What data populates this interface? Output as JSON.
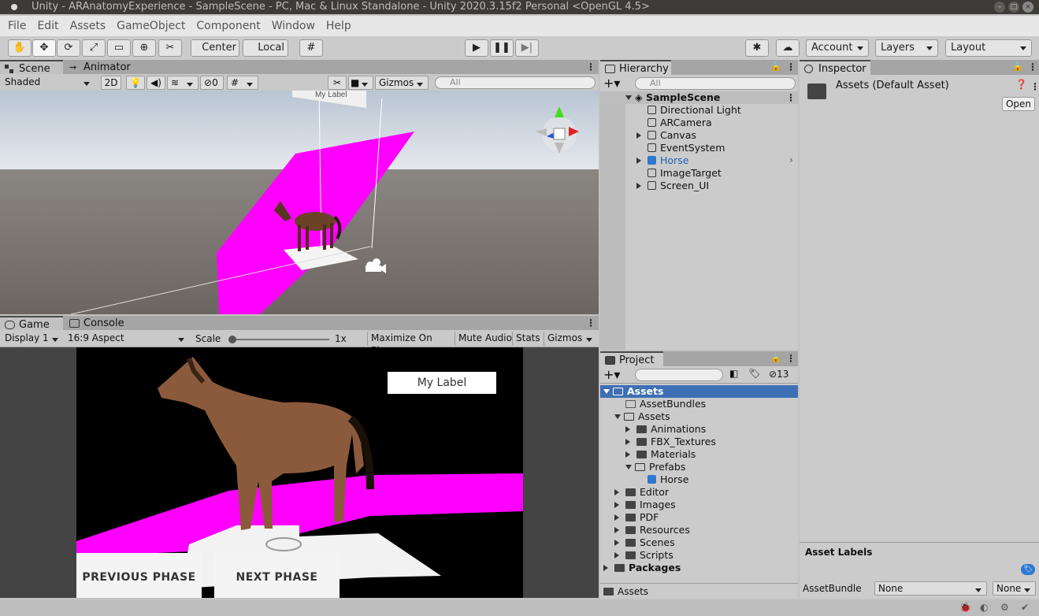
{
  "window": {
    "title": "Unity - ARAnatomyExperience - SampleScene - PC, Mac & Linux Standalone - Unity 2020.3.15f2 Personal <OpenGL 4.5>"
  },
  "menu": [
    "File",
    "Edit",
    "Assets",
    "GameObject",
    "Component",
    "Window",
    "Help"
  ],
  "toolbar": {
    "pivot_label": "Center",
    "space_label": "Local",
    "account_label": "Account",
    "layers_label": "Layers",
    "layout_label": "Layout",
    "tool_icons": [
      "hand-icon",
      "move-icon",
      "rotate-icon",
      "scale-icon",
      "rect-icon",
      "transform-icon",
      "custom-tool-icon"
    ]
  },
  "scene_panel": {
    "tabs": [
      "Scene",
      "Animator"
    ],
    "draw_mode": "Shaded",
    "mode_2d": "2D",
    "hidden_count": "0",
    "gizmos_label": "Gizmos",
    "search_placeholder": "All",
    "floating_label": "My Label"
  },
  "game_panel": {
    "tabs": [
      "Game",
      "Console"
    ],
    "display": "Display 1",
    "aspect": "16:9 Aspect",
    "scale_label": "Scale",
    "scale_value": "1x",
    "scale_fraction": 0.0,
    "maximize": "Maximize On Play",
    "mute": "Mute Audio",
    "stats": "Stats",
    "gizmos": "Gizmos",
    "my_label": "My Label",
    "prev_button": "PREVIOUS PHASE",
    "next_button": "NEXT PHASE"
  },
  "hierarchy": {
    "tab": "Hierarchy",
    "search_placeholder": "All",
    "scene": "SampleScene",
    "items": [
      {
        "label": "Directional Light",
        "expandable": false,
        "selected": false
      },
      {
        "label": "ARCamera",
        "expandable": false,
        "selected": false
      },
      {
        "label": "Canvas",
        "expandable": true,
        "selected": false
      },
      {
        "label": "EventSystem",
        "expandable": false,
        "selected": false
      },
      {
        "label": "Horse",
        "expandable": true,
        "selected": true
      },
      {
        "label": "ImageTarget",
        "expandable": false,
        "selected": false
      },
      {
        "label": "Screen_UI",
        "expandable": true,
        "selected": false
      }
    ]
  },
  "inspector": {
    "tab": "Inspector",
    "title": "Assets (Default Asset)",
    "open_label": "Open",
    "asset_labels": "Asset Labels",
    "asset_bundle_label": "AssetBundle",
    "asset_bundle_value": "None",
    "variant_value": "None"
  },
  "project": {
    "tab": "Project",
    "hidden_count": "13",
    "breadcrumb": "Assets",
    "tree": [
      {
        "label": "Assets",
        "depth": 0,
        "state": "open",
        "selected": true
      },
      {
        "label": "AssetBundles",
        "depth": 1,
        "state": "empty",
        "selected": false
      },
      {
        "label": "Assets",
        "depth": 1,
        "state": "open",
        "selected": false
      },
      {
        "label": "Animations",
        "depth": 2,
        "state": "closed",
        "selected": false
      },
      {
        "label": "FBX_Textures",
        "depth": 2,
        "state": "closed",
        "selected": false
      },
      {
        "label": "Materials",
        "depth": 2,
        "state": "closed",
        "selected": false
      },
      {
        "label": "Prefabs",
        "depth": 2,
        "state": "open",
        "selected": false
      },
      {
        "label": "Horse",
        "depth": 3,
        "state": "prefab",
        "selected": false
      },
      {
        "label": "Editor",
        "depth": 1,
        "state": "closed",
        "selected": false
      },
      {
        "label": "Images",
        "depth": 1,
        "state": "closed",
        "selected": false
      },
      {
        "label": "PDF",
        "depth": 1,
        "state": "closed",
        "selected": false
      },
      {
        "label": "Resources",
        "depth": 1,
        "state": "closed",
        "selected": false
      },
      {
        "label": "Scenes",
        "depth": 1,
        "state": "closed",
        "selected": false
      },
      {
        "label": "Scripts",
        "depth": 1,
        "state": "closed",
        "selected": false
      },
      {
        "label": "Packages",
        "depth": 0,
        "state": "closed",
        "selected": false
      }
    ]
  },
  "colors": {
    "selection": "#3d6fb5",
    "magenta": "#ff00ff",
    "horse": "#8b5a3c"
  }
}
